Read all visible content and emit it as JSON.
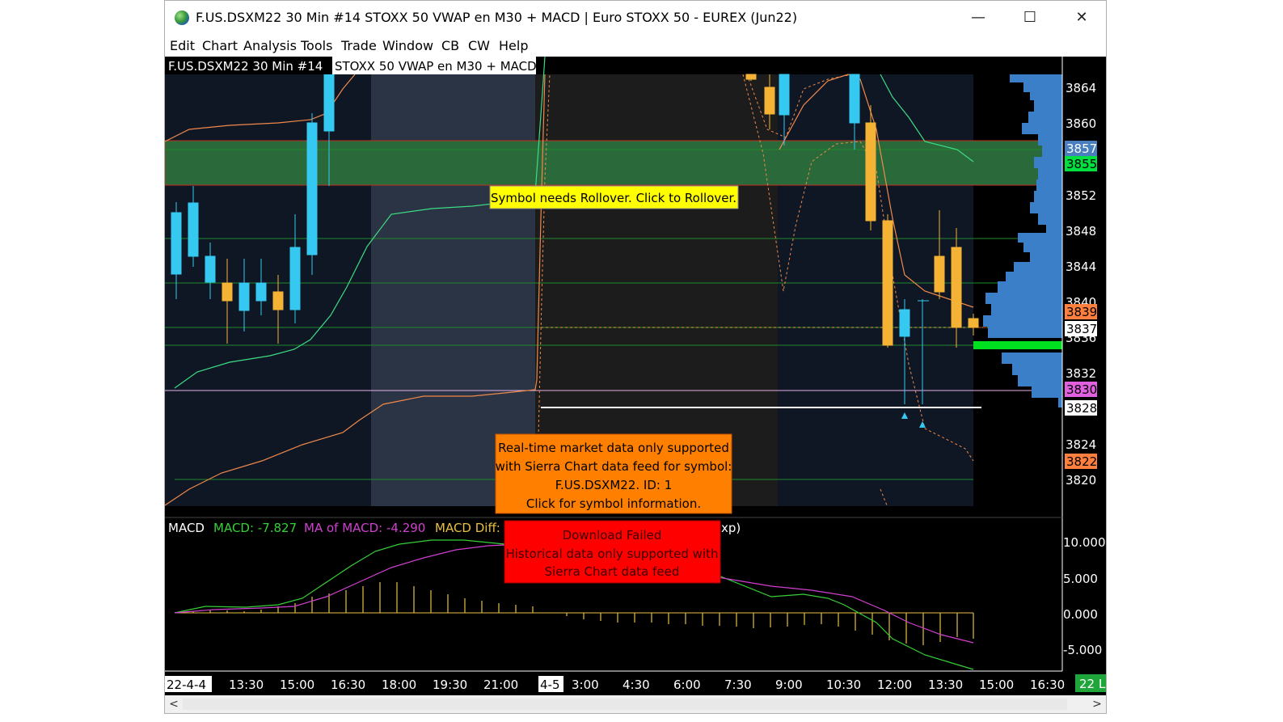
{
  "window": {
    "title": "F.US.DSXM22  30 Min   #14 STOXX 50 VWAP en M30 + MACD | Euro STOXX 50 - EUREX (Jun22)",
    "minimize": "—",
    "maximize": "☐",
    "close": "✕"
  },
  "menu": [
    "Edit",
    "Chart",
    "Analysis",
    "Tools",
    "Trade",
    "Window",
    "CB",
    "CW",
    "Help"
  ],
  "chart": {
    "header_symbol": "F.US.DSXM22  30 Min   #14",
    "header_study": "STOXX 50 VWAP en M30 + MACD",
    "price_ticks": [
      "3864",
      "3860",
      "3852",
      "3848",
      "3844",
      "3840",
      "3836",
      "3832",
      "3824",
      "3820"
    ],
    "price_labels": [
      {
        "text": "3857",
        "bg": "#4a7fbf",
        "fg": "#ffffff"
      },
      {
        "text": "3855",
        "bg": "#00e040",
        "fg": "#000000"
      },
      {
        "text": "3839",
        "bg": "#ff7f3f",
        "fg": "#000000"
      },
      {
        "text": "3837",
        "bg": "#ffffff",
        "fg": "#000000"
      },
      {
        "text": "3830",
        "bg": "#e060e0",
        "fg": "#000000"
      },
      {
        "text": "3828",
        "bg": "#ffffff",
        "fg": "#000000"
      },
      {
        "text": "3822",
        "bg": "#ff7f3f",
        "fg": "#000000"
      }
    ],
    "macd_ticks": [
      "10.000",
      "5.000",
      "0.000",
      "-5.000"
    ],
    "time_labels": [
      "22-4-4",
      "13:30",
      "15:00",
      "16:30",
      "18:00",
      "19:30",
      "21:00",
      "4-5",
      "3:00",
      "4:30",
      "6:00",
      "7:30",
      "9:00",
      "10:30",
      "12:00",
      "13:30",
      "15:00",
      "16:30"
    ],
    "corner_badge": "22 L",
    "macd_legend": {
      "name": "MACD",
      "macd": "MACD: -7.827",
      "ma": "MA of MACD: -4.290",
      "diff": "MACD Diff:",
      "tail": "xp)"
    },
    "rollover_notice": "Symbol needs Rollover. Click to Rollover.",
    "realtime_notice": [
      "Real-time market data only supported",
      "with Sierra Chart data feed for symbol:",
      "F.US.DSXM22.  ID: 1",
      "Click for symbol information."
    ],
    "download_notice": [
      "Download Failed",
      "Historical data only supported with",
      "Sierra Chart data feed"
    ],
    "colors": {
      "up_candle": "#35c8f0",
      "down_candle": "#f5b335",
      "vwap": "#3ddc84",
      "band": "#f0894a",
      "macd": "#35d035",
      "macd_ma": "#d040d0",
      "macd_diff": "#e8c040",
      "zone": "#2a6a3a"
    }
  },
  "scrollbar": {
    "left": "<",
    "right": ">"
  }
}
